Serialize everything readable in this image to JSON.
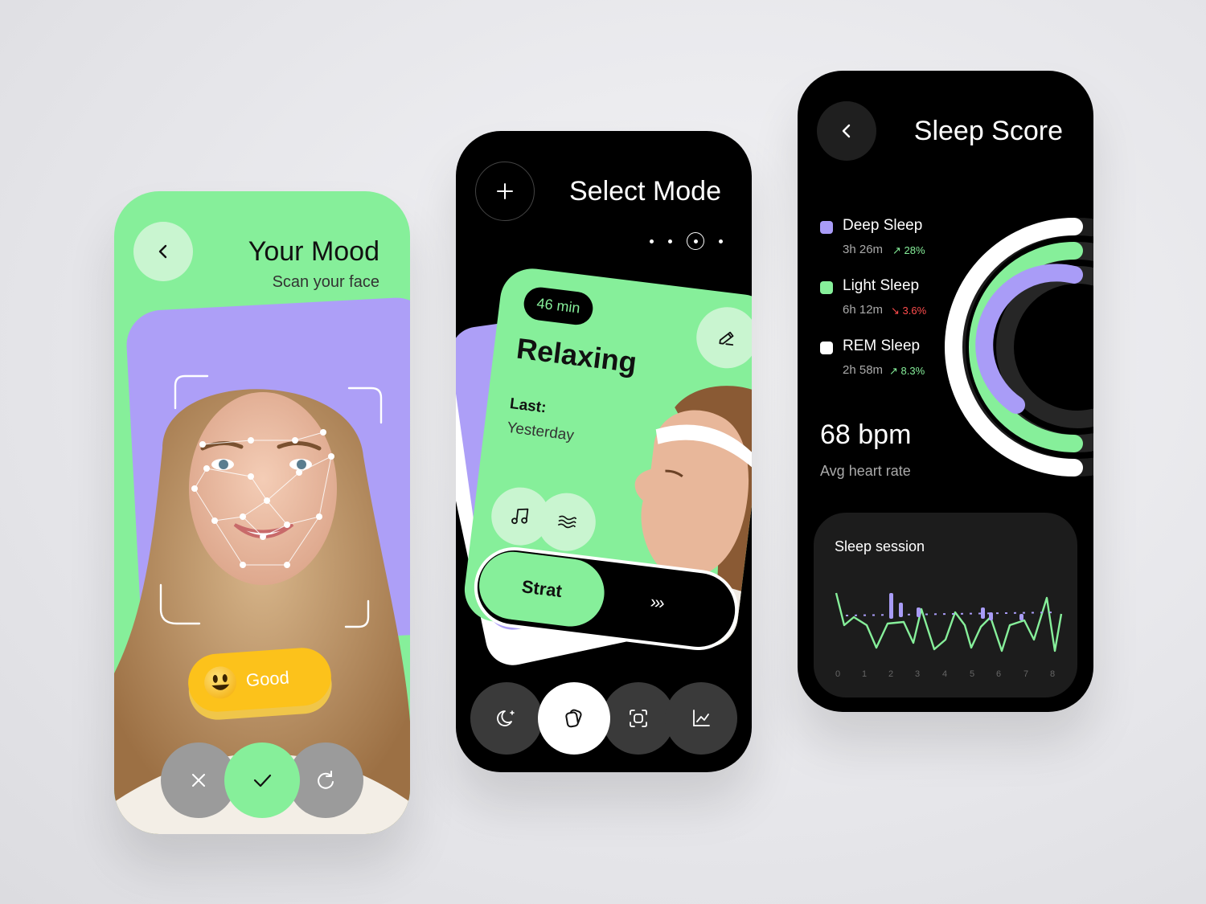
{
  "mood_screen": {
    "title": "Your Mood",
    "subtitle": "Scan your face",
    "mood_label": "Good"
  },
  "mode_screen": {
    "title": "Select Mode",
    "card": {
      "duration": "46 min",
      "name": "Relaxing",
      "last_label": "Last:",
      "last_value": "Yesterday",
      "start_label": "Strat",
      "arrows": "›››"
    }
  },
  "sleep_screen": {
    "title": "Sleep Score",
    "stages": [
      {
        "name": "Deep Sleep",
        "duration": "3h 26m",
        "change": "↗ 28%",
        "color": "#a99cf7",
        "change_color": "#86ef9a"
      },
      {
        "name": "Light Sleep",
        "duration": "6h 12m",
        "change": "↘ 3.6%",
        "color": "#86ef9a",
        "change_color": "#ff4d4d"
      },
      {
        "name": "REM Sleep",
        "duration": "2h 58m",
        "change": "↗ 8.3%",
        "color": "#ffffff",
        "change_color": "#86ef9a"
      }
    ],
    "bpm": "68 bpm",
    "bpm_label": "Avg heart rate",
    "session_title": "Sleep session",
    "x_ticks": [
      "0",
      "1",
      "2",
      "3",
      "4",
      "5",
      "6",
      "7",
      "8"
    ]
  },
  "colors": {
    "green": "#86ef9a",
    "purple": "#ad9ff7",
    "yellow": "#fcc21b",
    "black": "#000000"
  }
}
